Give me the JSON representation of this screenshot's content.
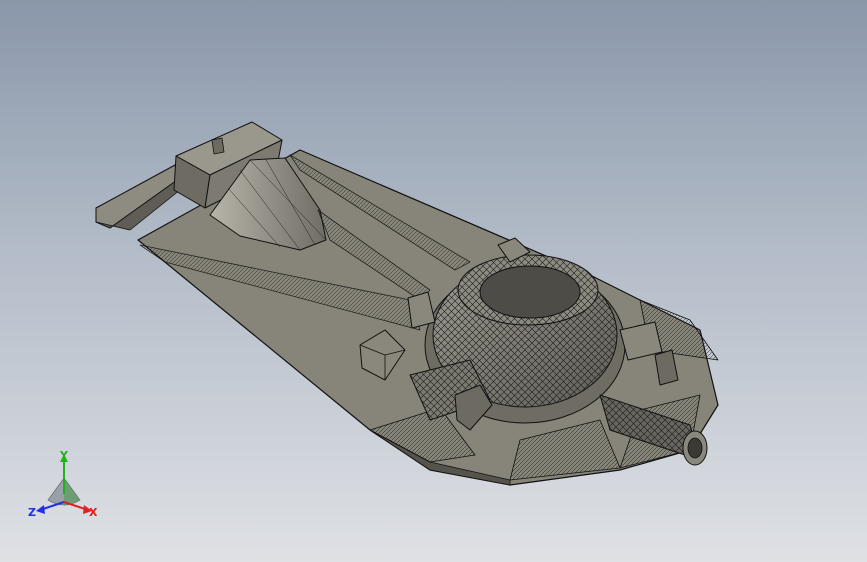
{
  "scene": {
    "background": {
      "top": "#8a97aa",
      "bottom": "#dfe1e5"
    },
    "model": {
      "style": "wireframe-shaded",
      "face_color": "#7e7c72",
      "edge_color": "#111111"
    }
  },
  "triad": {
    "x_label": "X",
    "x_color": "#e02020",
    "y_label": "Y",
    "y_color": "#20b020",
    "z_label": "Z",
    "z_color": "#2030e0"
  }
}
